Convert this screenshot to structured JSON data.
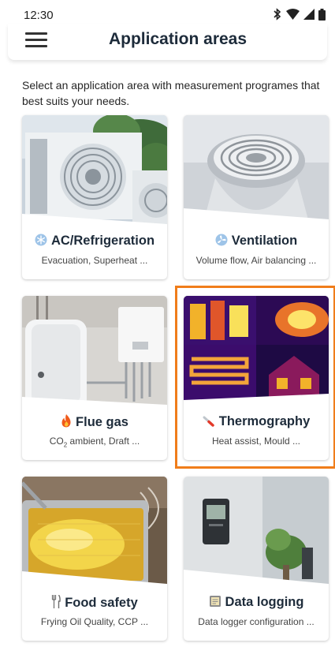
{
  "status": {
    "time": "12:30",
    "icons": [
      "bluetooth-icon",
      "wifi-icon",
      "signal-icon",
      "battery-icon"
    ]
  },
  "header": {
    "title": "Application areas",
    "menu_icon": "hamburger-menu-icon"
  },
  "intro": "Select an application area with measurement programes that best suits your needs.",
  "accent_color": "#f07d1a",
  "cards": [
    {
      "title": "AC/Refrigeration",
      "subtitle": "Evacuation, Superheat ...",
      "icon": "snowflake-icon"
    },
    {
      "title": "Ventilation",
      "subtitle": "Volume flow, Air balancing ...",
      "icon": "fan-icon"
    },
    {
      "title": "Flue gas",
      "subtitle_main": "CO",
      "subtitle_sub": "2",
      "subtitle_rest": " ambient, Draft ...",
      "icon": "flame-icon"
    },
    {
      "title": "Thermography",
      "subtitle": "Heat assist, Mould ...",
      "icon": "thermometer-icon",
      "selected": true
    },
    {
      "title": "Food safety",
      "subtitle": "Frying Oil Quality, CCP ...",
      "icon": "cutlery-icon"
    },
    {
      "title": "Data logging",
      "subtitle": "Data logger configuration ...",
      "icon": "clipboard-icon"
    }
  ]
}
